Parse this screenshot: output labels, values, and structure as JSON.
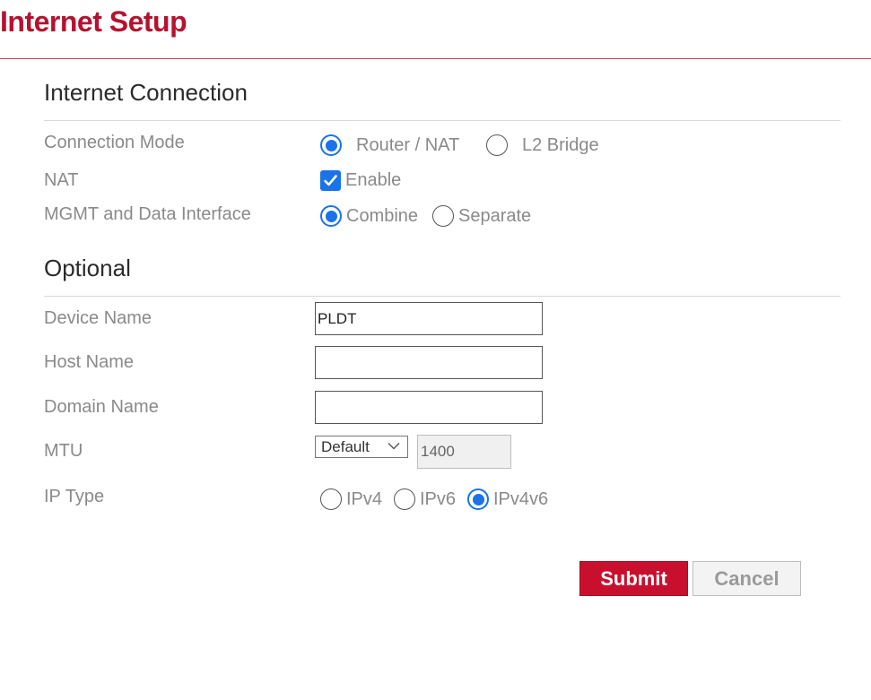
{
  "header": {
    "title": "Internet Setup"
  },
  "sections": {
    "internet_connection": {
      "title": "Internet Connection"
    },
    "optional": {
      "title": "Optional"
    }
  },
  "connection_mode": {
    "label": "Connection Mode",
    "options": [
      {
        "label": "Router / NAT",
        "selected": true
      },
      {
        "label": "L2 Bridge",
        "selected": false
      }
    ]
  },
  "nat": {
    "label": "NAT",
    "checkbox_label": "Enable",
    "checked": true
  },
  "mgmt_interface": {
    "label": "MGMT and Data Interface",
    "options": [
      {
        "label": "Combine",
        "selected": true
      },
      {
        "label": "Separate",
        "selected": false
      }
    ]
  },
  "device_name": {
    "label": "Device Name",
    "value": "PLDT"
  },
  "host_name": {
    "label": "Host Name",
    "value": ""
  },
  "domain_name": {
    "label": "Domain Name",
    "value": ""
  },
  "mtu": {
    "label": "MTU",
    "select_value": "Default",
    "value": "1400"
  },
  "ip_type": {
    "label": "IP Type",
    "options": [
      {
        "label": "IPv4",
        "selected": false
      },
      {
        "label": "IPv6",
        "selected": false
      },
      {
        "label": "IPv4v6",
        "selected": true
      }
    ]
  },
  "actions": {
    "submit_label": "Submit",
    "cancel_label": "Cancel"
  },
  "colors": {
    "brand": "#c8102e",
    "accent": "#1a73e8"
  }
}
